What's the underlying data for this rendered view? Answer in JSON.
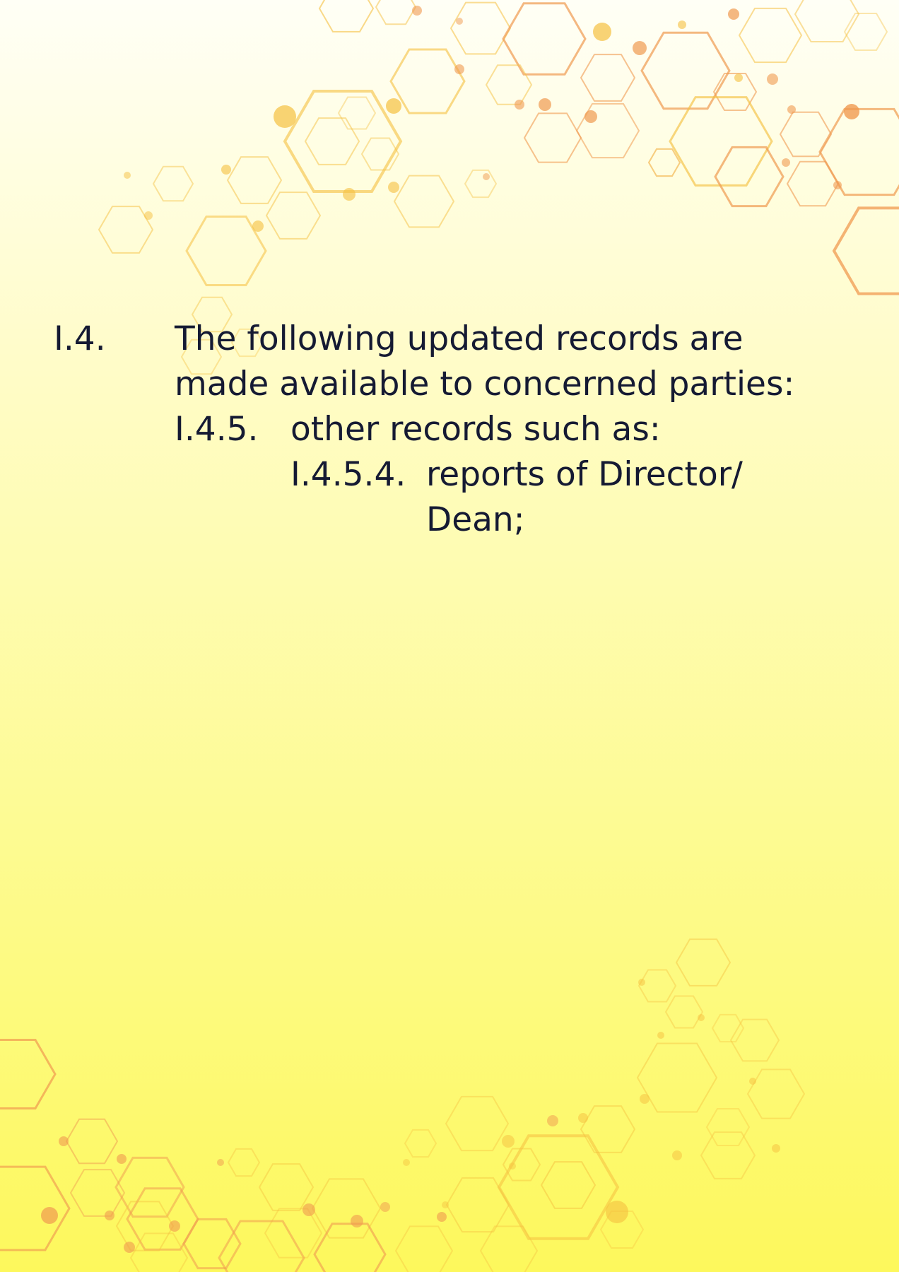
{
  "background": {
    "gradient_top": "#fffff6",
    "gradient_bottom": "#fdf85c",
    "pattern": "hexagon-network",
    "pattern_colors": [
      "#f5c040",
      "#f09a50"
    ]
  },
  "text_color": "#151a33",
  "items": [
    {
      "number": "I.4.",
      "lines": [
        "The following updated records are",
        "made available to concerned parties:"
      ]
    },
    {
      "number": "I.4.5.",
      "lines": [
        "other records such as:"
      ]
    },
    {
      "number": "I.4.5.4.",
      "lines": [
        "reports of Director/",
        "Dean;"
      ]
    }
  ]
}
